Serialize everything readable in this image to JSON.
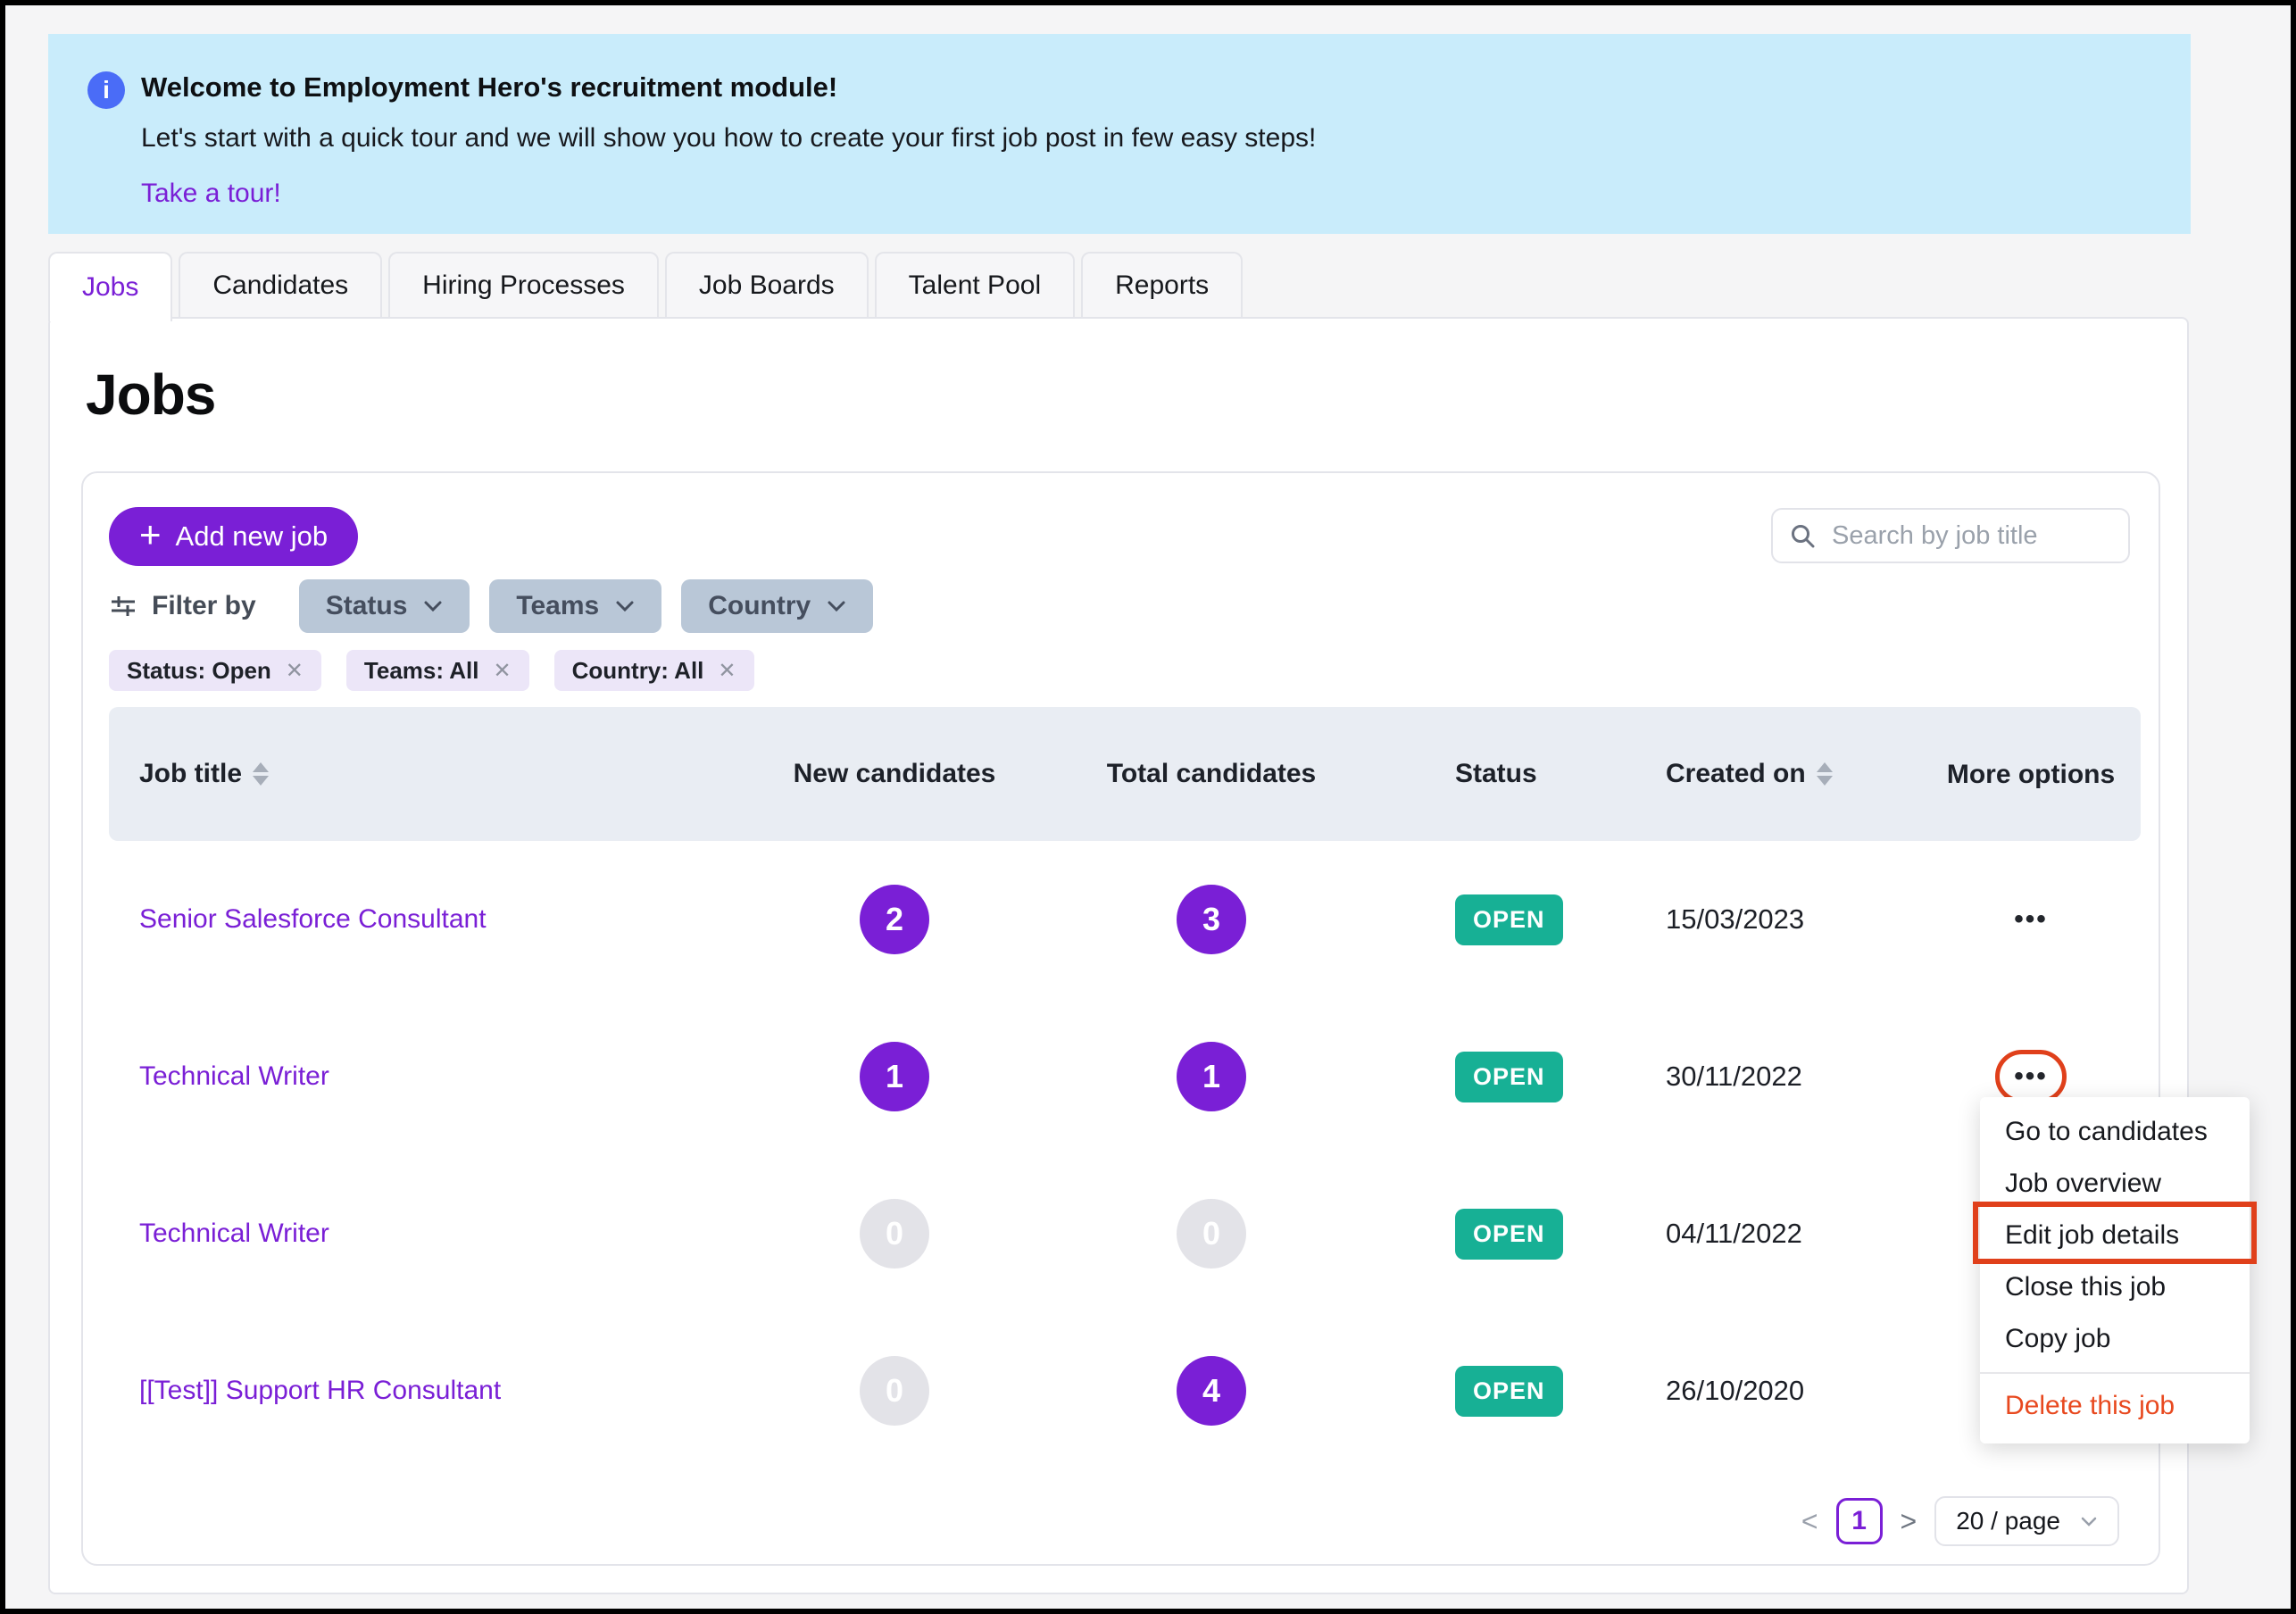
{
  "banner": {
    "title": "Welcome to Employment Hero's recruitment module!",
    "subtitle": "Let's start with a quick tour and we will show you how to create your first job post in few easy steps!",
    "link": "Take a tour!"
  },
  "tabs": [
    {
      "label": "Jobs",
      "active": true
    },
    {
      "label": "Candidates",
      "active": false
    },
    {
      "label": "Hiring Processes",
      "active": false
    },
    {
      "label": "Job Boards",
      "active": false
    },
    {
      "label": "Talent Pool",
      "active": false
    },
    {
      "label": "Reports",
      "active": false
    }
  ],
  "page": {
    "title": "Jobs"
  },
  "toolbar": {
    "add_job_label": "Add new job",
    "search_placeholder": "Search by job title"
  },
  "filters": {
    "label": "Filter by",
    "dropdowns": [
      {
        "label": "Status"
      },
      {
        "label": "Teams"
      },
      {
        "label": "Country"
      }
    ],
    "chips": [
      {
        "label": "Status: Open"
      },
      {
        "label": "Teams: All"
      },
      {
        "label": "Country: All"
      }
    ]
  },
  "table": {
    "headers": {
      "job_title": "Job title",
      "new_candidates": "New candidates",
      "total_candidates": "Total candidates",
      "status": "Status",
      "created_on": "Created on",
      "more_options": "More options"
    },
    "rows": [
      {
        "title": "Senior Salesforce Consultant",
        "new_candidates": "2",
        "total_candidates": "3",
        "status": "OPEN",
        "created_on": "15/03/2023",
        "more_annotated": false
      },
      {
        "title": "Technical Writer",
        "new_candidates": "1",
        "total_candidates": "1",
        "status": "OPEN",
        "created_on": "30/11/2022",
        "more_annotated": true
      },
      {
        "title": "Technical Writer",
        "new_candidates": "0",
        "total_candidates": "0",
        "status": "OPEN",
        "created_on": "04/11/2022",
        "more_annotated": false
      },
      {
        "title": "[[Test]] Support HR Consultant",
        "new_candidates": "0",
        "total_candidates": "4",
        "status": "OPEN",
        "created_on": "26/10/2020",
        "more_annotated": false
      }
    ]
  },
  "context_menu": {
    "items": [
      {
        "label": "Go to candidates",
        "highlighted": false,
        "danger": false
      },
      {
        "label": "Job overview",
        "highlighted": false,
        "danger": false
      },
      {
        "label": "Edit job details",
        "highlighted": true,
        "danger": false
      },
      {
        "label": "Close this job",
        "highlighted": false,
        "danger": false
      },
      {
        "label": "Copy job",
        "highlighted": false,
        "danger": false
      },
      {
        "label": "Delete this job",
        "highlighted": false,
        "danger": true
      }
    ]
  },
  "pagination": {
    "prev_glyph": "<",
    "current_page": "1",
    "next_glyph": ">",
    "page_size": "20 / page"
  },
  "glyphs": {
    "info": "i",
    "plus": "+",
    "chip_close": "✕",
    "more_options_dots": "•••"
  },
  "colors": {
    "brand_purple": "#7A1FD6",
    "status_teal": "#17B095",
    "banner_bg": "#C9ECFB",
    "info_blue": "#4A6CF7",
    "annotation_red": "#E0401B",
    "danger_red": "#E8491F",
    "header_bg": "#E9EDF3",
    "filter_button_bg": "#B9C7D7",
    "chip_bg": "#ECE6F8"
  }
}
